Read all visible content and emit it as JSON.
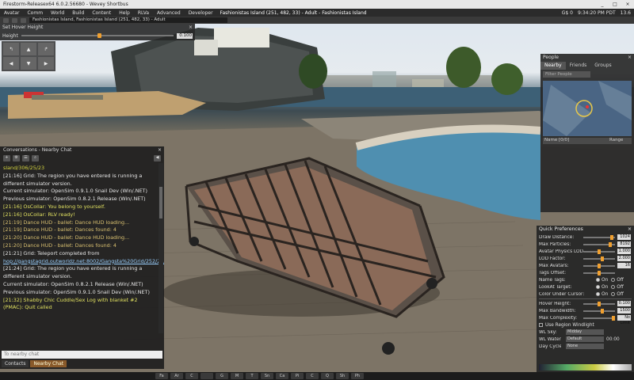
{
  "window": {
    "title": "Firestorm-Releasex64 6.0.2.56680 - Wevey Shortbus",
    "minimize": "_",
    "maximize": "□",
    "close": "×"
  },
  "menubar": {
    "items": [
      "Avatar",
      "Comm",
      "World",
      "Build",
      "Content",
      "Help",
      "RLVa",
      "Advanced",
      "Developer"
    ],
    "location": "Fashionistas Island (251, 482, 33) - Adult - Fashionistas Island",
    "balance": "G$ 0",
    "clock": "9:34:20 PM PDT",
    "fps": "13.6"
  },
  "navbar": {
    "address": "Fashionistas Island, Fashionistas Island (251, 482, 33) - Adult"
  },
  "hover_height": {
    "title": "Set Hover Height",
    "label": "Height",
    "value": "0.100",
    "level": 0.5,
    "close": "×"
  },
  "move_controls": [
    "↰",
    "▲",
    "↱",
    "◀",
    "▼",
    "▶"
  ],
  "chat": {
    "title": "Conversations - Nearby Chat",
    "tools": [
      "+",
      "⚙",
      "☰",
      "⌕"
    ],
    "context": "◀",
    "close": "×",
    "lines": [
      {
        "cls": "cur",
        "text": "sland/306/25/23"
      },
      {
        "cls": "sys",
        "text": "[21:16] Grid: The region you have entered is running a different simulator version."
      },
      {
        "cls": "sys",
        "text": "Current simulator: OpenSim 0.9.1.0 Snail Dev (Win/.NET)"
      },
      {
        "cls": "sys",
        "text": "Previous simulator: OpenSim 0.8.2.1 Release (Win/.NET)"
      },
      {
        "cls": "os",
        "text": "[21:16] OsCollar: You belong to yourself."
      },
      {
        "cls": "os",
        "text": "[21:16] OsCollar: RLV ready!"
      },
      {
        "cls": "hud",
        "text": "[21:19] Dance HUD - ballet: Dance HUD loading..."
      },
      {
        "cls": "hud",
        "text": "[21:19] Dance HUD - ballet: Dances found: 4"
      },
      {
        "cls": "hud",
        "text": "[21:20] Dance HUD - ballet: Dance HUD loading..."
      },
      {
        "cls": "hud",
        "text": "[21:20] Dance HUD - ballet: Dances found: 4"
      },
      {
        "cls": "sys",
        "text": "[21:21] Grid: Teleport completed from"
      },
      {
        "cls": "link",
        "text": "hop://gangstagrid.outworldz.net:8002/Gangsta%20Grid/252/20/3/30"
      },
      {
        "cls": "sys",
        "text": "[21:24] Grid: The region you have entered is running a different simulator version."
      },
      {
        "cls": "sys",
        "text": "Current simulator: OpenSim 0.8.2.1 Release (Win/.NET)"
      },
      {
        "cls": "sys",
        "text": "Previous simulator: OpenSim 0.9.1.0 Snail Dev (Win/.NET)"
      },
      {
        "cls": "shabby",
        "text": "[21:32] Shabby Chic Cuddle/Sex Log with blanket #2 (PMAC): Quit called"
      }
    ],
    "input_placeholder": "To nearby chat",
    "tabs": [
      "Contacts",
      "Nearby Chat"
    ]
  },
  "people": {
    "title": "People",
    "tabs": [
      "Nearby",
      "Friends",
      "Groups"
    ],
    "filter_placeholder": "Filter People",
    "col_name": "Name [0/0]",
    "col_range": "Range",
    "close": "×"
  },
  "quick_prefs": {
    "title": "Quick Preferences",
    "close": "×",
    "sliders": [
      {
        "label": "Draw Distance:",
        "value": "1024",
        "level": 0.95
      },
      {
        "label": "Max Particles:",
        "value": "8192",
        "level": 0.9
      },
      {
        "label": "Avatar Physics LOD:",
        "value": "1.000",
        "level": 0.5
      },
      {
        "label": "LOD Factor:",
        "value": "2.000",
        "level": 0.6
      },
      {
        "label": "Max Avatars:",
        "value": "16",
        "level": 0.5
      },
      {
        "label": "Tags Offset:",
        "value": "",
        "level": 0.5
      }
    ],
    "radios": [
      {
        "label": "Name Tags:",
        "on": "On",
        "off": "Off"
      },
      {
        "label": "LookAt Target:",
        "on": "On",
        "off": "Off"
      },
      {
        "label": "Color Under Cursor:",
        "on": "On",
        "off": "Off"
      }
    ],
    "sliders2": [
      {
        "label": "Hover Height:",
        "value": "0.100",
        "level": 0.5
      },
      {
        "label": "Max Bandwidth:",
        "value": "1500",
        "level": 0.6
      },
      {
        "label": "Max Complexity:",
        "value": "No Limit",
        "level": 1.0
      }
    ],
    "windlight_check": "Use Region Windlight",
    "wl_sky_label": "WL Sky:",
    "wl_sky_value": "Midday",
    "wl_water_label": "WL Water:",
    "wl_water_value": "Default",
    "wl_water_time": "00:00",
    "daycycle_label": "Day Cycle:",
    "daycycle_value": "None"
  },
  "toolbar": [
    "Fa",
    "Ar",
    "C",
    "",
    "G",
    "M",
    "T",
    "Sn",
    "Ca",
    "Pi",
    "C",
    "Q",
    "Sh",
    "Ph"
  ]
}
